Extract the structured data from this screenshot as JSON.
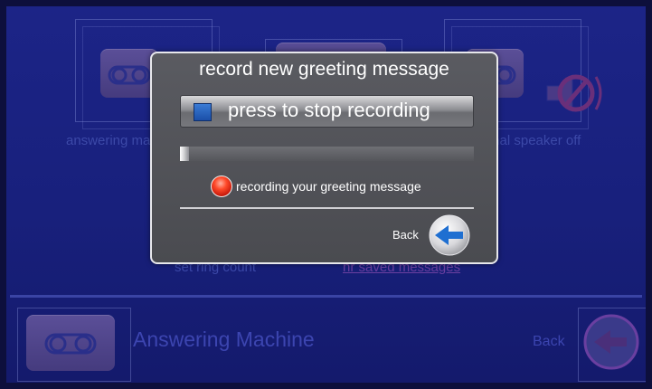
{
  "background": {
    "buttons": [
      {
        "label": "answering machine"
      },
      {
        "label": "internal speaker off"
      }
    ],
    "links": [
      {
        "label": "set ring count"
      },
      {
        "label": "hr saved messages"
      }
    ],
    "footer": {
      "title": "Answering Machine",
      "back_label": "Back"
    }
  },
  "dialog": {
    "title": "record new greeting message",
    "stop_button_label": "press to stop recording",
    "progress_percent": 3,
    "status_text": "recording your greeting message",
    "back_label": "Back"
  },
  "colors": {
    "background": "#1c2487",
    "dialog": "#55565b",
    "stop_square": "#2462bf",
    "record_dot": "#e8321a",
    "back_arrow": "#1f6fd1"
  },
  "icons": {
    "stop": "stop-square-icon",
    "recording": "record-dot-icon",
    "back": "back-arrow-icon",
    "tape": "cassette-tape-icon",
    "speaker_off": "speaker-off-icon"
  }
}
